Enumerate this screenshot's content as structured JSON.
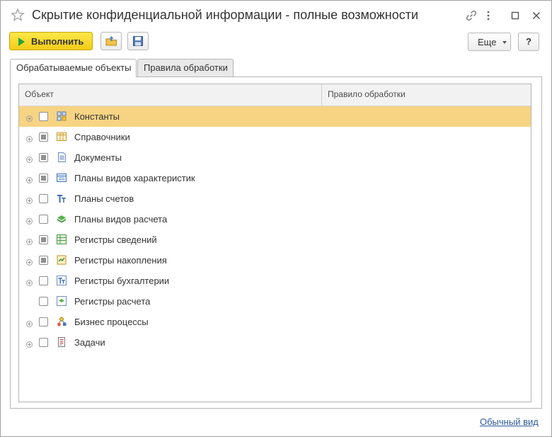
{
  "window": {
    "title": "Скрытие конфиденциальной информации - полные возможности"
  },
  "toolbar": {
    "run_label": "Выполнить",
    "more_label": "Еще",
    "help_label": "?"
  },
  "tabs": [
    {
      "label": "Обрабатываемые объекты",
      "active": true
    },
    {
      "label": "Правила обработки",
      "active": false
    }
  ],
  "grid": {
    "columns": [
      "Объект",
      "Правило обработки"
    ],
    "rows": [
      {
        "label": "Константы",
        "icon": "constants-icon",
        "expandable": true,
        "check": "unchecked",
        "selected": true,
        "rule": ""
      },
      {
        "label": "Справочники",
        "icon": "catalogs-icon",
        "expandable": true,
        "check": "indeterminate",
        "selected": false,
        "rule": ""
      },
      {
        "label": "Документы",
        "icon": "documents-icon",
        "expandable": true,
        "check": "indeterminate",
        "selected": false,
        "rule": ""
      },
      {
        "label": "Планы видов характеристик",
        "icon": "characteristic-types-icon",
        "expandable": true,
        "check": "indeterminate",
        "selected": false,
        "rule": ""
      },
      {
        "label": "Планы счетов",
        "icon": "chart-of-accounts-icon",
        "expandable": true,
        "check": "unchecked",
        "selected": false,
        "rule": ""
      },
      {
        "label": "Планы видов расчета",
        "icon": "calculation-types-icon",
        "expandable": true,
        "check": "unchecked",
        "selected": false,
        "rule": ""
      },
      {
        "label": "Регистры сведений",
        "icon": "information-registers-icon",
        "expandable": true,
        "check": "indeterminate",
        "selected": false,
        "rule": ""
      },
      {
        "label": "Регистры накопления",
        "icon": "accumulation-registers-icon",
        "expandable": true,
        "check": "indeterminate",
        "selected": false,
        "rule": ""
      },
      {
        "label": "Регистры бухгалтерии",
        "icon": "accounting-registers-icon",
        "expandable": true,
        "check": "unchecked",
        "selected": false,
        "rule": ""
      },
      {
        "label": "Регистры расчета",
        "icon": "calculation-registers-icon",
        "expandable": false,
        "check": "unchecked",
        "selected": false,
        "rule": ""
      },
      {
        "label": "Бизнес процессы",
        "icon": "business-processes-icon",
        "expandable": true,
        "check": "unchecked",
        "selected": false,
        "rule": ""
      },
      {
        "label": "Задачи",
        "icon": "tasks-icon",
        "expandable": true,
        "check": "unchecked",
        "selected": false,
        "rule": ""
      }
    ]
  },
  "footer": {
    "normal_view_link": "Обычный вид"
  },
  "colors": {
    "run_button": "#f5d21e",
    "selected_row": "#f7d483",
    "link": "#2d5b9a"
  }
}
